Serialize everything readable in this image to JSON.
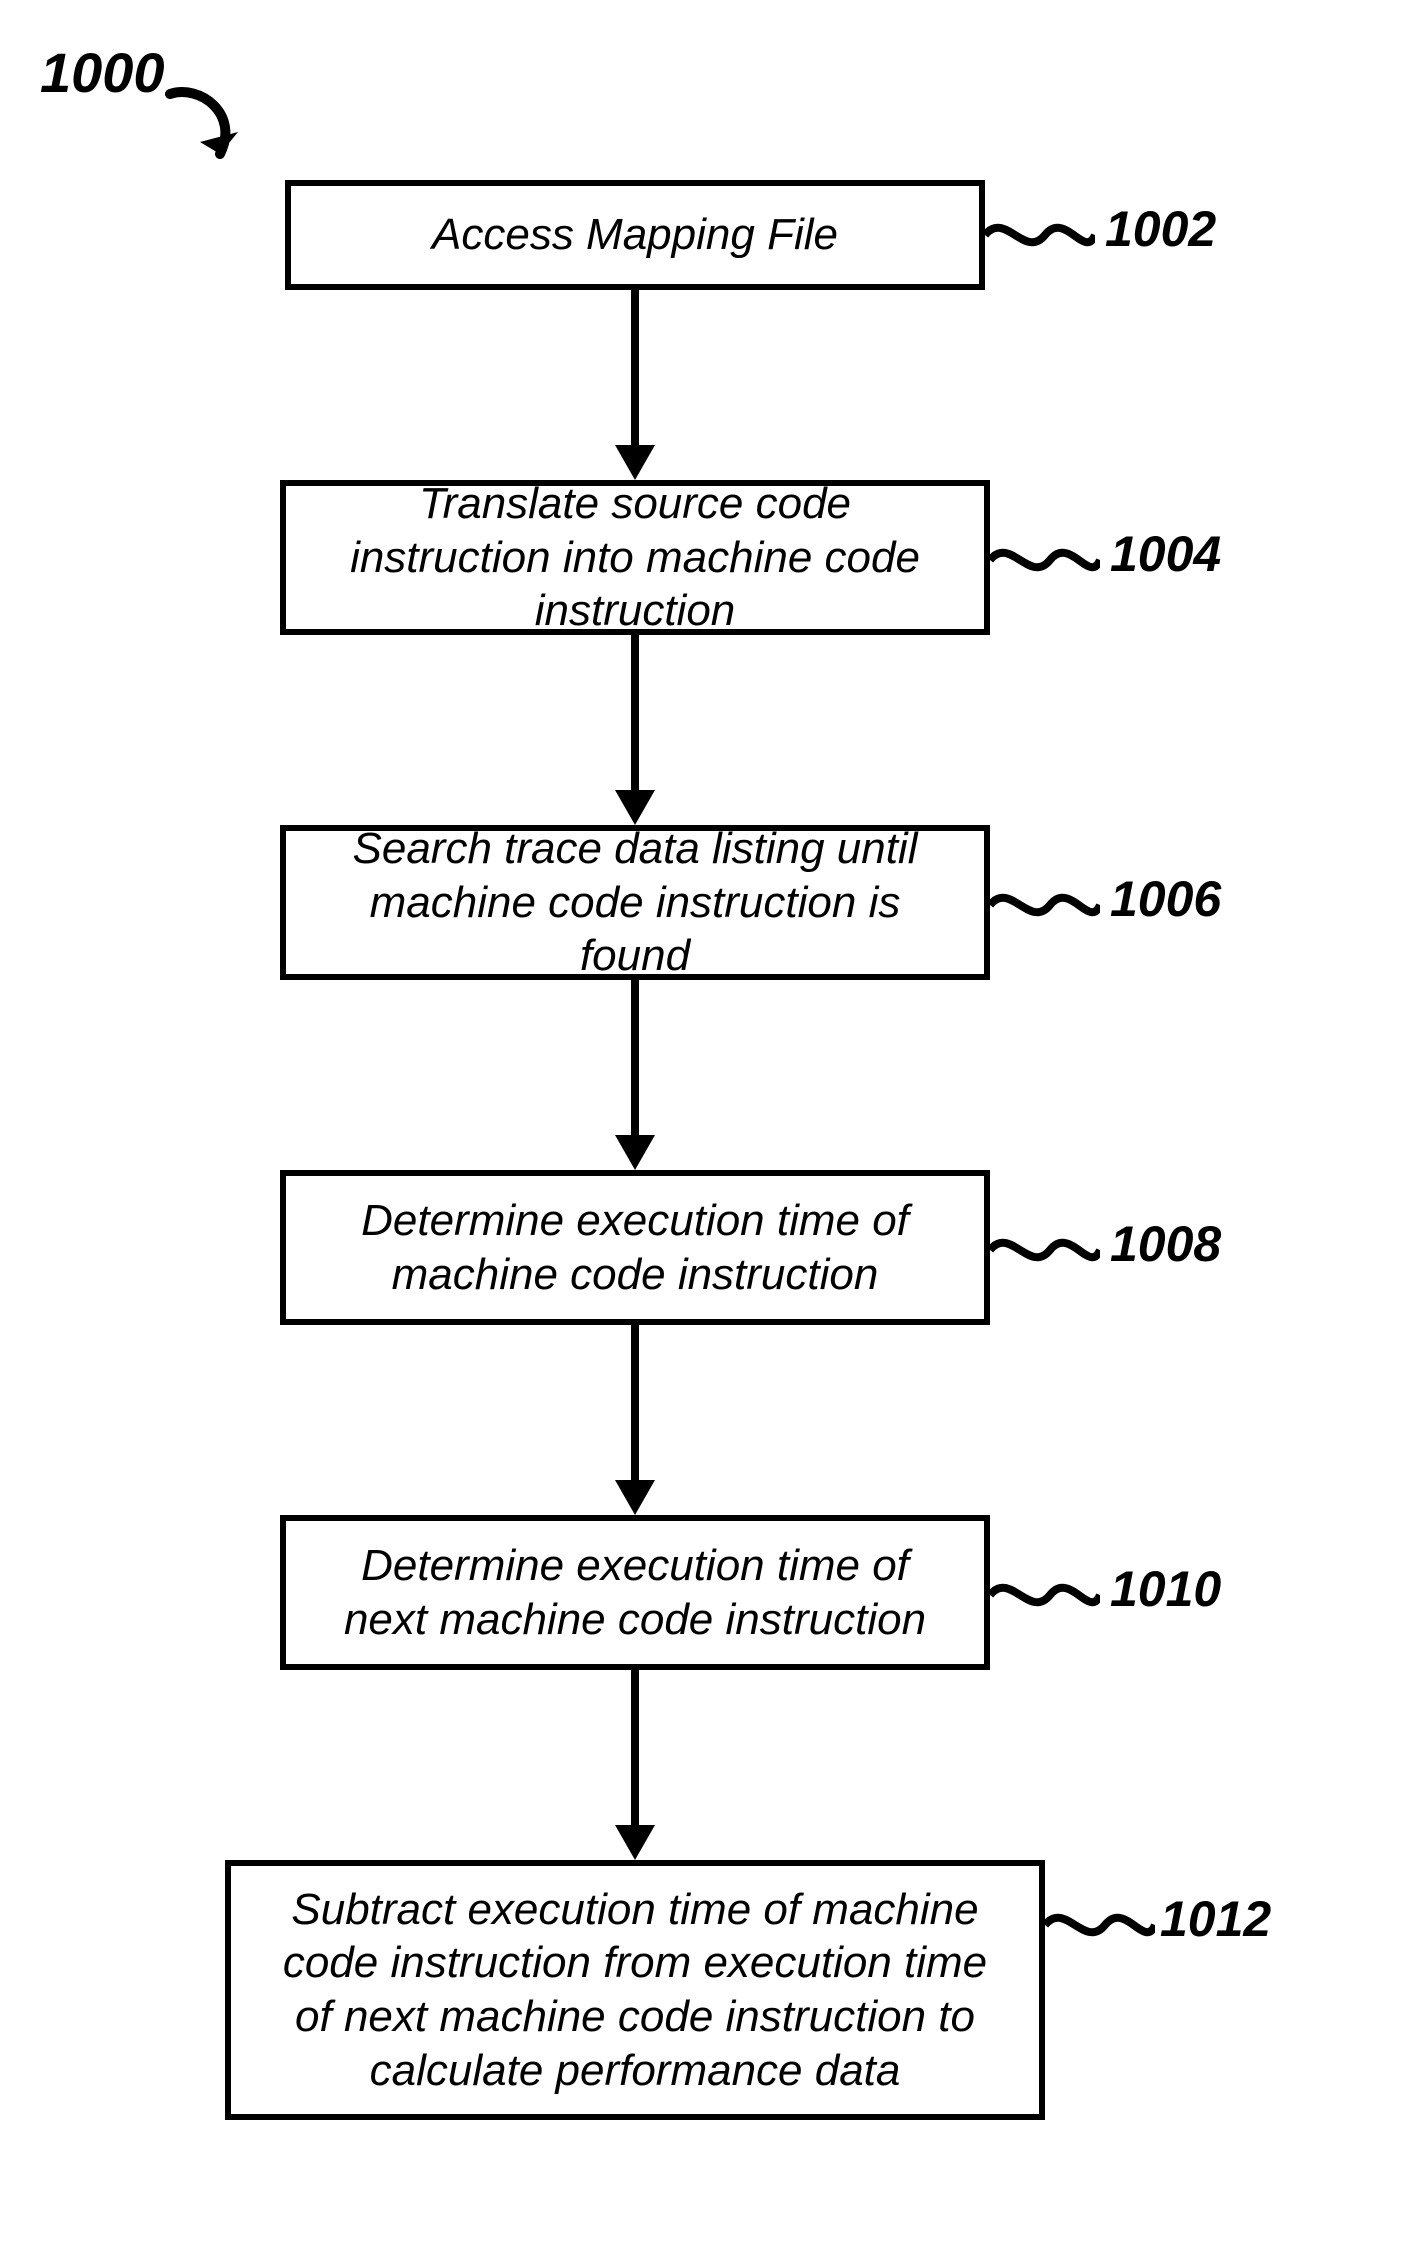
{
  "chart_data": {
    "type": "flowchart",
    "title": "1000",
    "steps": [
      {
        "id": "1002",
        "text": "Access Mapping File"
      },
      {
        "id": "1004",
        "text": "Translate source code instruction into machine code instruction"
      },
      {
        "id": "1006",
        "text": "Search trace data listing until machine code instruction is found"
      },
      {
        "id": "1008",
        "text": "Determine execution time of machine code instruction"
      },
      {
        "id": "1010",
        "text": "Determine execution time of next machine code instruction"
      },
      {
        "id": "1012",
        "text": "Subtract execution time of machine code instruction from execution time of next machine code instruction to calculate performance data"
      }
    ],
    "edges": [
      [
        "1002",
        "1004"
      ],
      [
        "1004",
        "1006"
      ],
      [
        "1006",
        "1008"
      ],
      [
        "1008",
        "1010"
      ],
      [
        "1010",
        "1012"
      ]
    ]
  },
  "figure": {
    "number": "1000"
  },
  "steps": {
    "s1": {
      "text": "Access Mapping File",
      "label": "1002"
    },
    "s2": {
      "text": "Translate source code instruction into machine code instruction",
      "label": "1004"
    },
    "s3": {
      "text": "Search trace data listing until machine code instruction is found",
      "label": "1006"
    },
    "s4": {
      "text": "Determine execution time of machine code instruction",
      "label": "1008"
    },
    "s5": {
      "text": "Determine execution time of next machine code instruction",
      "label": "1010"
    },
    "s6": {
      "text": "Subtract execution time of machine code instruction from execution time of next machine code instruction to calculate performance data",
      "label": "1012"
    }
  }
}
